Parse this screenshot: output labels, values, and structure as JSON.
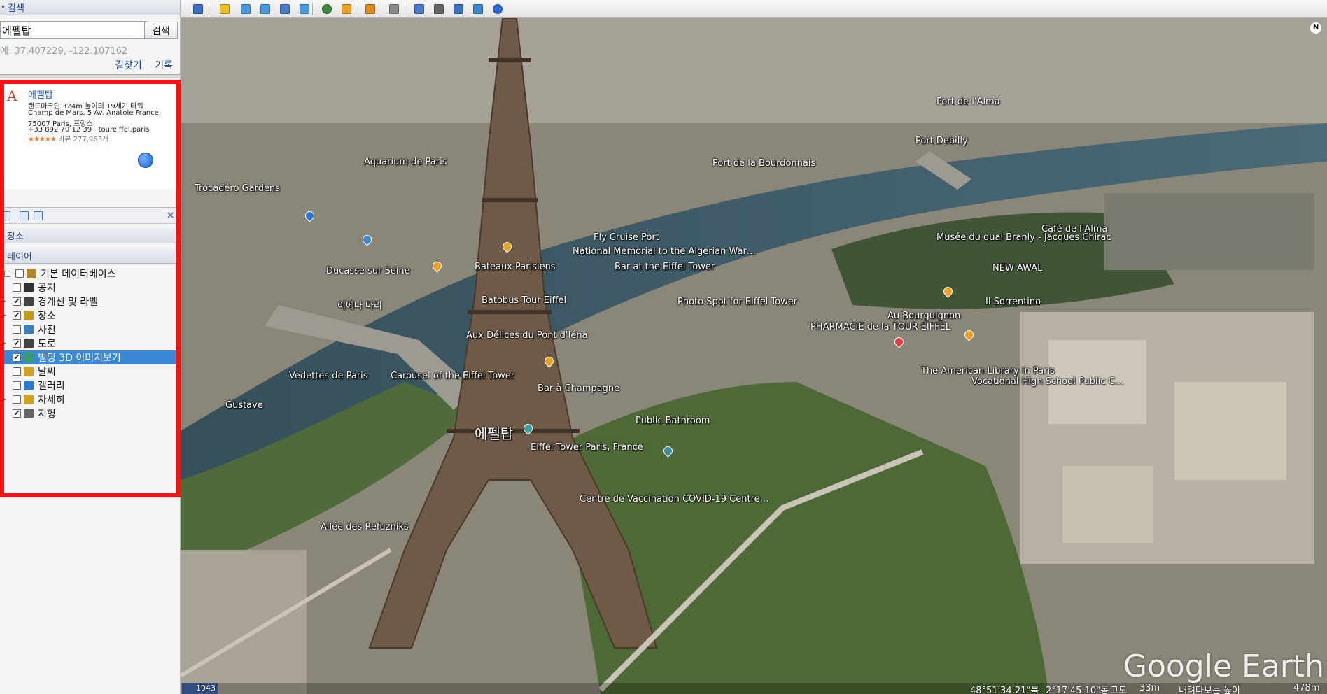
{
  "search": {
    "header": "검색",
    "query": "에펠탑",
    "button": "검색",
    "hint": "예: 37.407229, -122.107162",
    "links": [
      "길찾기",
      "기록"
    ]
  },
  "result": {
    "marker": "A",
    "title": "에펠탑",
    "desc": "랜드마크인 324m 높이의 19세기 타워",
    "address1": "Champ de Mars, 5 Av. Anatole France,",
    "address2": "75007 Paris, 프랑스",
    "phone": "+33 892 70 12 39 · toureiffel.paris",
    "stars": "★★★★★",
    "reviews": "리뷰 277,963개"
  },
  "places": {
    "header": "장소",
    "close": "✕"
  },
  "layers": {
    "header": "레이어",
    "items": [
      {
        "label": "기본 데이터베이스",
        "checked": "",
        "level": 0
      },
      {
        "label": "공지",
        "checked": "",
        "level": 1
      },
      {
        "label": "경계선 및 라벨",
        "checked": "✔",
        "level": 1
      },
      {
        "label": "장소",
        "checked": "✔",
        "level": 1
      },
      {
        "label": "사진",
        "checked": "",
        "level": 1
      },
      {
        "label": "도로",
        "checked": "✔",
        "level": 1
      },
      {
        "label": "빌딩 3D 이미지보기",
        "checked": "✔",
        "level": 1,
        "selected": true
      },
      {
        "label": "날씨",
        "checked": "",
        "level": 1
      },
      {
        "label": "갤러리",
        "checked": "",
        "level": 1
      },
      {
        "label": "자세히",
        "checked": "",
        "level": 1
      },
      {
        "label": "지형",
        "checked": "✔",
        "level": 1
      }
    ]
  },
  "map": {
    "labels": [
      "Trocadéro Gardens",
      "Aquarium de Paris",
      "Musée du quai Branly - Jacques Chirac",
      "Port Debilly",
      "Port de la Bourdonnais",
      "Bateaux Parisiens",
      "Batobus Tour Eiffel",
      "Aux Délices du Pont d'Iéna",
      "Carousel of the Eiffel Tower",
      "Vedettes de Paris",
      "Bar à Champagne",
      "에펠탑",
      "Eiffel Tower Paris, France",
      "Public Bathroom",
      "Centre de Vaccination COVID-19 Centre…",
      "Photo Spot for Eiffel Tower",
      "PHARMACIE de la TOUR EIFFEL",
      "The American Library in Paris",
      "Vocational High School Public C…",
      "Ducasse sur Seine",
      "이에나 다리",
      "NEW AWAL",
      "Gustave",
      "Allée des Refuzniks",
      "Café de l'Alma",
      "National Memorial to the Algerian War…",
      "Fly Cruise Port",
      "Port de l'Alma",
      "Il Sorrentino",
      "Au Bourguignon",
      "Bar at the Eiffel Tower"
    ],
    "watermark": "Google Earth",
    "year": "1943",
    "status_lat": "48°51'34.21\"북",
    "status_lon": "2°17'45.10\"동",
    "status_alt_label": "고도",
    "status_alt": "33m",
    "status_eye_label": "내려다보는 높이",
    "status_eye": "478m",
    "compass": "N"
  },
  "toolbar": {
    "icons": [
      "sidebar-toggle-icon",
      "placemark-icon",
      "polygon-icon",
      "path-icon",
      "image-overlay-icon",
      "record-tour-icon",
      "historical-imagery-icon",
      "sunlight-icon",
      "planets-icon",
      "ruler-icon",
      "email-icon",
      "print-icon",
      "save-image-icon",
      "view-maps-icon",
      "earth-gallery-icon"
    ]
  }
}
